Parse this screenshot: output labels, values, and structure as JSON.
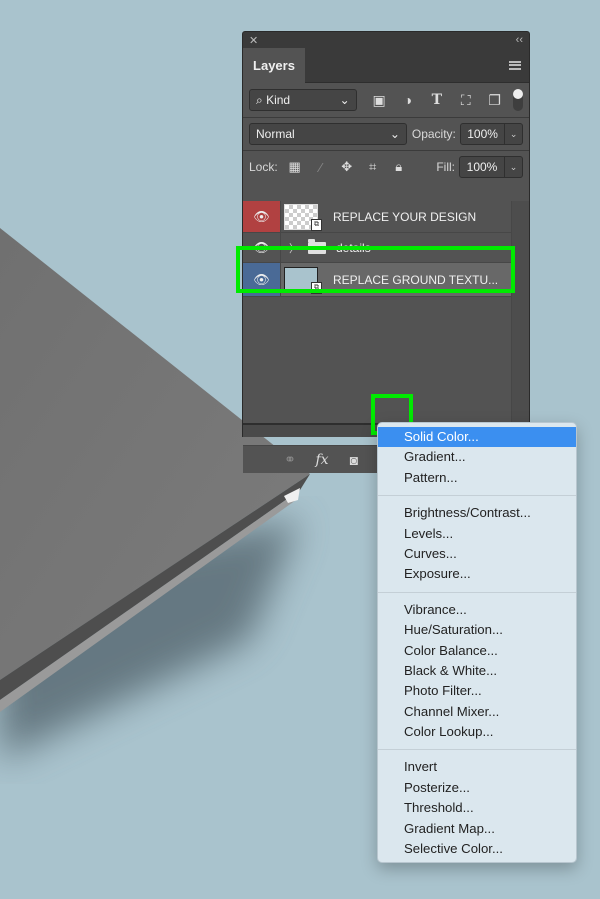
{
  "panel": {
    "close_glyph": "✕",
    "collapse_glyph": "‹‹",
    "tab_label": "Layers",
    "filter": {
      "kind_label": "Kind",
      "search_glyph": "⌕",
      "icons": [
        "image-filter-icon",
        "adjustment-filter-icon",
        "type-filter-icon",
        "shape-filter-icon",
        "smart-object-filter-icon"
      ]
    },
    "blend_mode": "Normal",
    "opacity_label": "Opacity:",
    "opacity_value": "100%",
    "lock_label": "Lock:",
    "fill_label": "Fill:",
    "fill_value": "100%",
    "layers": [
      {
        "name": "REPLACE YOUR DESIGN",
        "eye_color": "#b14141",
        "type": "smart-object"
      },
      {
        "name": "details",
        "type": "group"
      },
      {
        "name": "REPLACE GROUND TEXTU...",
        "eye_color": "#4a6a96",
        "type": "smart-object",
        "selected": true
      }
    ],
    "highlight_color": "#00ea00"
  },
  "menu": {
    "groups": [
      [
        "Solid Color...",
        "Gradient...",
        "Pattern..."
      ],
      [
        "Brightness/Contrast...",
        "Levels...",
        "Curves...",
        "Exposure..."
      ],
      [
        "Vibrance...",
        "Hue/Saturation...",
        "Color Balance...",
        "Black & White...",
        "Photo Filter...",
        "Channel Mixer...",
        "Color Lookup..."
      ],
      [
        "Invert",
        "Posterize...",
        "Threshold...",
        "Gradient Map...",
        "Selective Color..."
      ]
    ],
    "active_item": "Solid Color...",
    "active_color": "#3b8ff0"
  },
  "labels": {
    "g0": [
      "Solid Color...",
      "Gradient...",
      "Pattern..."
    ],
    "g1": [
      "Brightness/Contrast...",
      "Levels...",
      "Curves...",
      "Exposure..."
    ],
    "g2": [
      "Vibrance...",
      "Hue/Saturation...",
      "Color Balance...",
      "Black & White...",
      "Photo Filter...",
      "Channel Mixer...",
      "Color Lookup..."
    ],
    "g3": [
      "Invert",
      "Posterize...",
      "Threshold...",
      "Gradient Map...",
      "Selective Color..."
    ]
  },
  "background_color": "#a9c3cd"
}
